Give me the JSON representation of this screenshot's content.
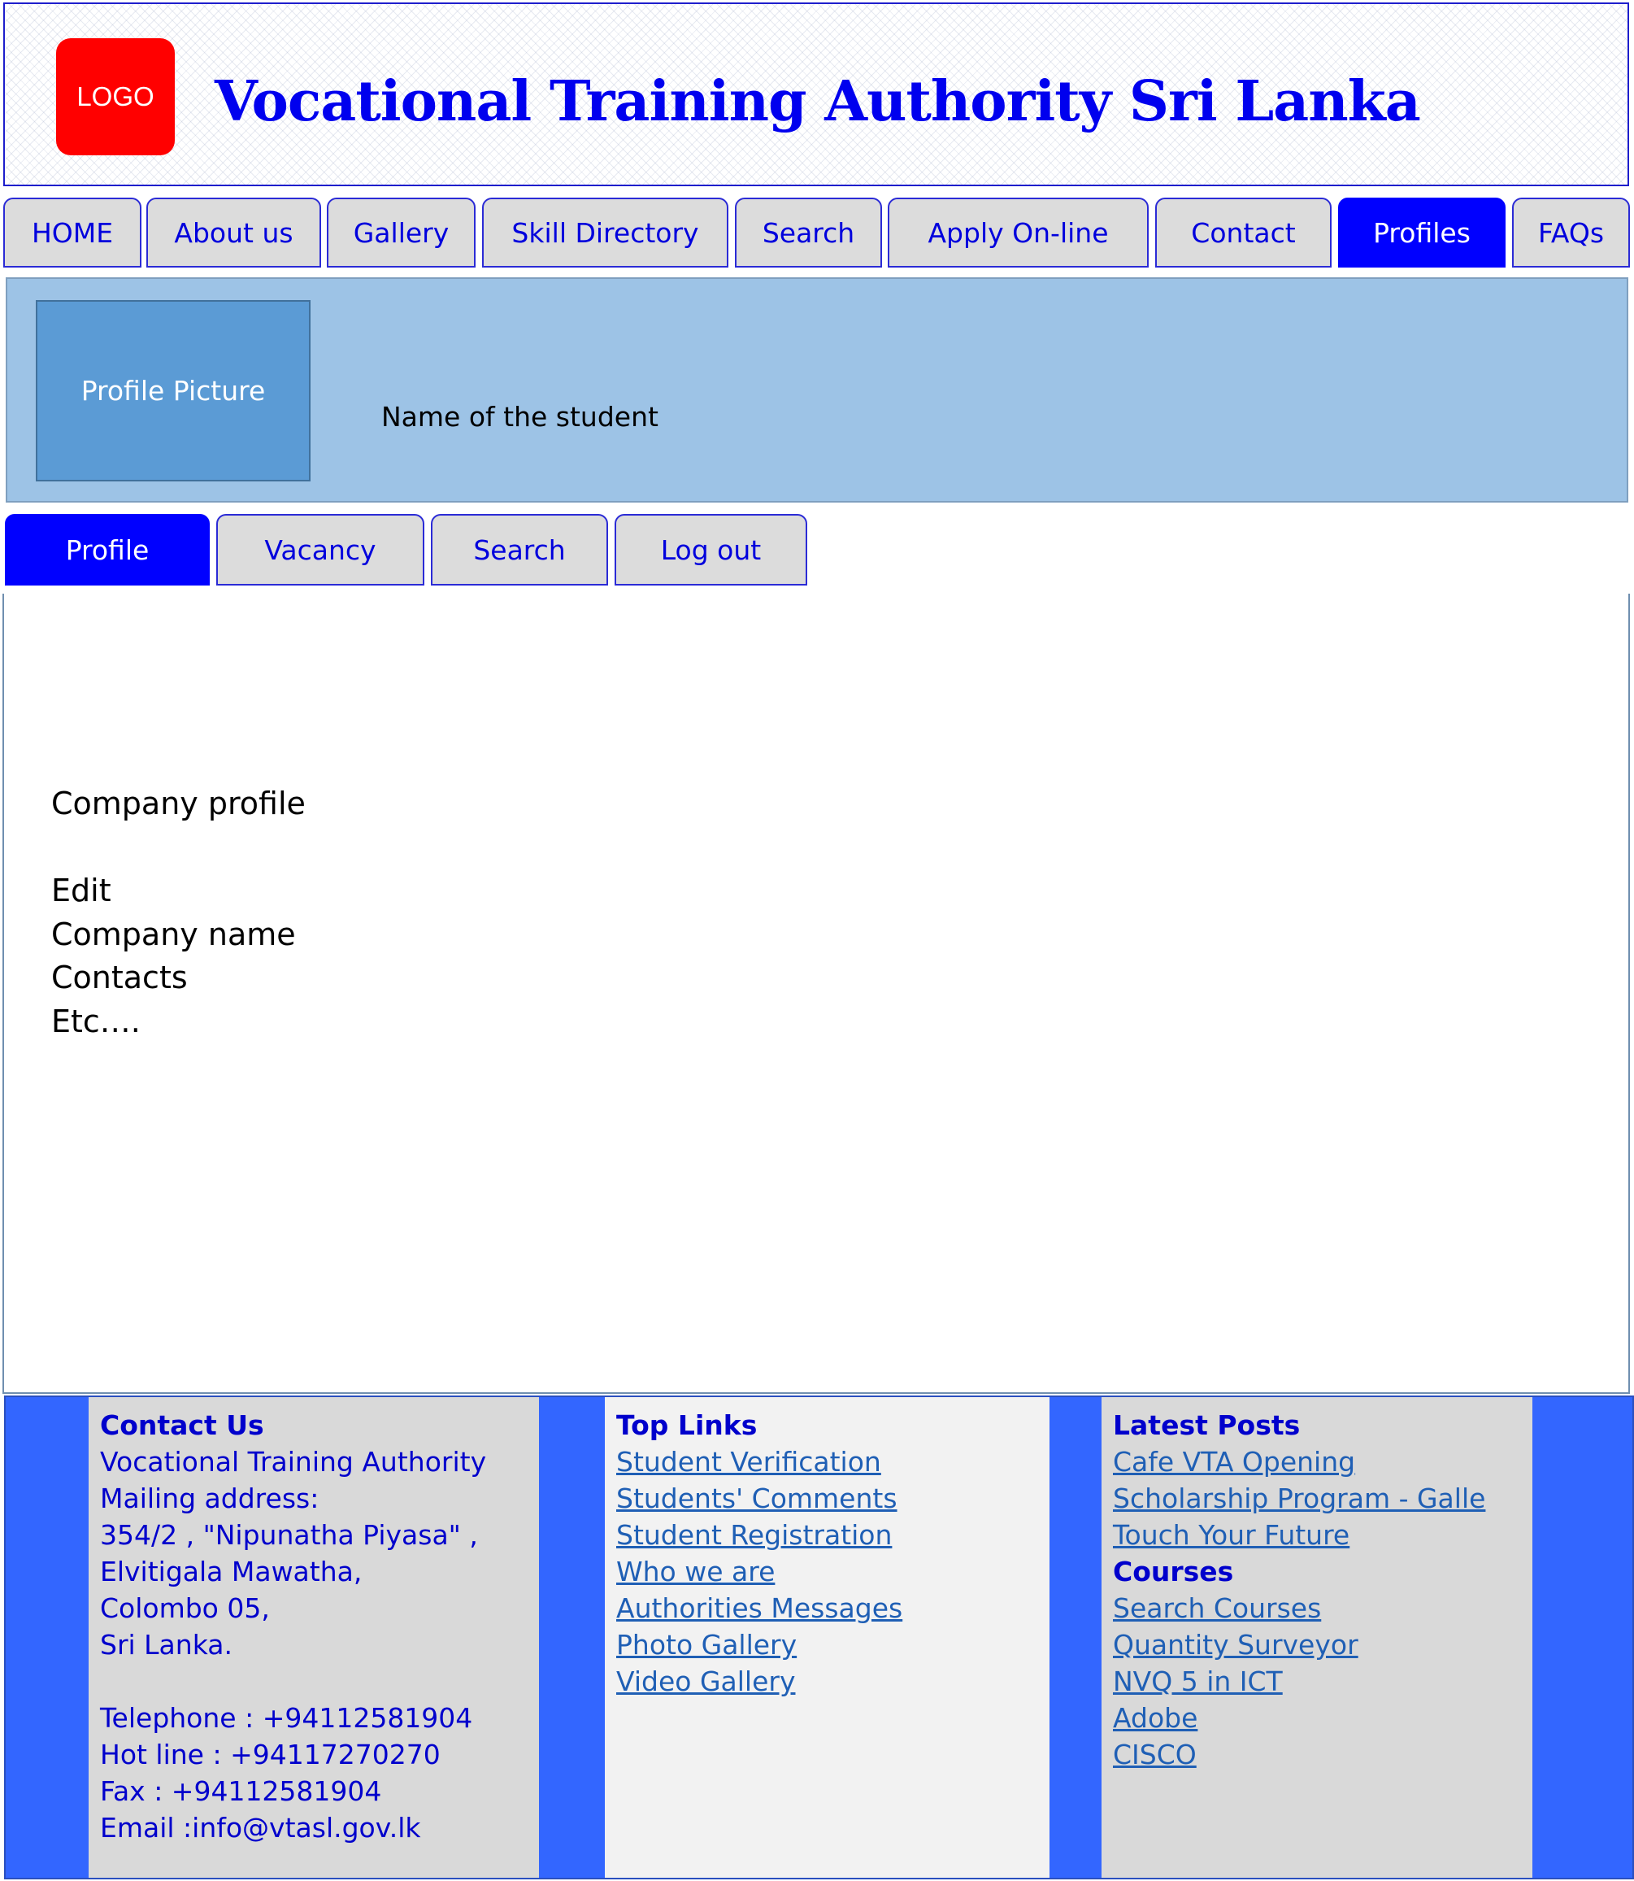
{
  "header": {
    "logo_text": "LOGO",
    "site_title": "Vocational Training Authority Sri Lanka"
  },
  "nav": {
    "items": [
      "HOME",
      "About us",
      "Gallery",
      "Skill Directory",
      "Search",
      "Apply On-line",
      "Contact",
      "Profiles",
      "FAQs"
    ],
    "active": "Profiles"
  },
  "profile": {
    "picture_label": "Profile Picture",
    "name": "Name of the student"
  },
  "subnav": {
    "items": [
      "Profile",
      "Vacancy",
      "Search",
      "Log out"
    ],
    "active": "Profile"
  },
  "content": {
    "heading": "Company profile",
    "lines": [
      "Edit",
      "Company name",
      "Contacts",
      "Etc…."
    ]
  },
  "footer": {
    "contact": {
      "heading": "Contact Us",
      "lines": [
        "Vocational Training Authority",
        "Mailing address:",
        "354/2 , \"Nipunatha Piyasa\" ,",
        "Elvitigala Mawatha,",
        "Colombo 05,",
        "Sri Lanka."
      ],
      "phone_lines": [
        "Telephone : +94112581904",
        "Hot line : +94117270270",
        "Fax : +94112581904",
        "Email :info@vtasl.gov.lk"
      ]
    },
    "top_links": {
      "heading": "Top Links",
      "links": [
        "Student Verification",
        "Students' Comments",
        "Student Registration",
        "Who we are",
        "Authorities Messages",
        "Photo Gallery",
        "Video Gallery"
      ]
    },
    "latest_posts": {
      "heading": "Latest Posts",
      "links": [
        "Cafe VTA Opening",
        "Scholarship Program - Galle",
        "Touch Your Future"
      ]
    },
    "courses": {
      "heading": "Courses",
      "links": [
        "Search Courses",
        "Quantity Surveyor",
        "NVQ 5 in ICT",
        "Adobe",
        "CISCO"
      ]
    }
  },
  "colors": {
    "accent": "#0000ff",
    "logo": "#ff0000",
    "banner": "#9dc3e6",
    "profile_picture": "#5b9bd5",
    "footer_band": "#3366ff",
    "tab_inactive": "#dcdcdc"
  }
}
